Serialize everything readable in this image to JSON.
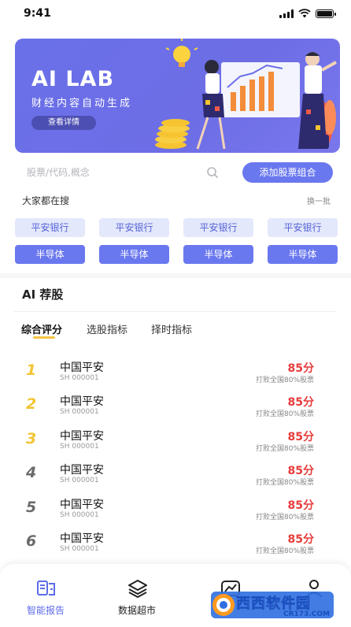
{
  "status": {
    "time": "9:41"
  },
  "banner": {
    "title": "AI LAB",
    "subtitle": "财经内容自动生成",
    "button": "查看详情"
  },
  "search": {
    "placeholder": "股票/代码,概念",
    "add_button": "添加股票组合"
  },
  "hot": {
    "title": "大家都在搜",
    "refresh": "换一批",
    "row1": [
      "平安银行",
      "平安银行",
      "平安银行",
      "平安银行"
    ],
    "row2": [
      "半导体",
      "半导体",
      "半导体",
      "半导体"
    ]
  },
  "ai": {
    "title": "AI 荐股",
    "tabs": [
      "综合评分",
      "选股指标",
      "择时指标"
    ],
    "stocks": [
      {
        "rank": "1",
        "name": "中国平安",
        "code": "SH 000001",
        "score": "85分",
        "note": "打败全国80%股票"
      },
      {
        "rank": "2",
        "name": "中国平安",
        "code": "SH 000001",
        "score": "85分",
        "note": "打败全国80%股票"
      },
      {
        "rank": "3",
        "name": "中国平安",
        "code": "SH 000001",
        "score": "85分",
        "note": "打败全国80%股票"
      },
      {
        "rank": "4",
        "name": "中国平安",
        "code": "SH 000001",
        "score": "85分",
        "note": "打败全国80%股票"
      },
      {
        "rank": "5",
        "name": "中国平安",
        "code": "SH 000001",
        "score": "85分",
        "note": "打败全国80%股票"
      },
      {
        "rank": "6",
        "name": "中国平安",
        "code": "SH 000001",
        "score": "85分",
        "note": "打败全国80%股票"
      }
    ]
  },
  "tabbar": {
    "items": [
      {
        "label": "智能报告",
        "icon": "report-icon"
      },
      {
        "label": "数据超市",
        "icon": "layers-icon"
      },
      {
        "label": "",
        "icon": "chart-icon"
      },
      {
        "label": "",
        "icon": "profile-icon"
      }
    ]
  },
  "watermark": {
    "text": "西西软件园",
    "url": "CR173.COM"
  },
  "colors": {
    "accent": "#6a78ef",
    "score_red": "#e73b3b",
    "rank_gold": "#f2c534"
  }
}
